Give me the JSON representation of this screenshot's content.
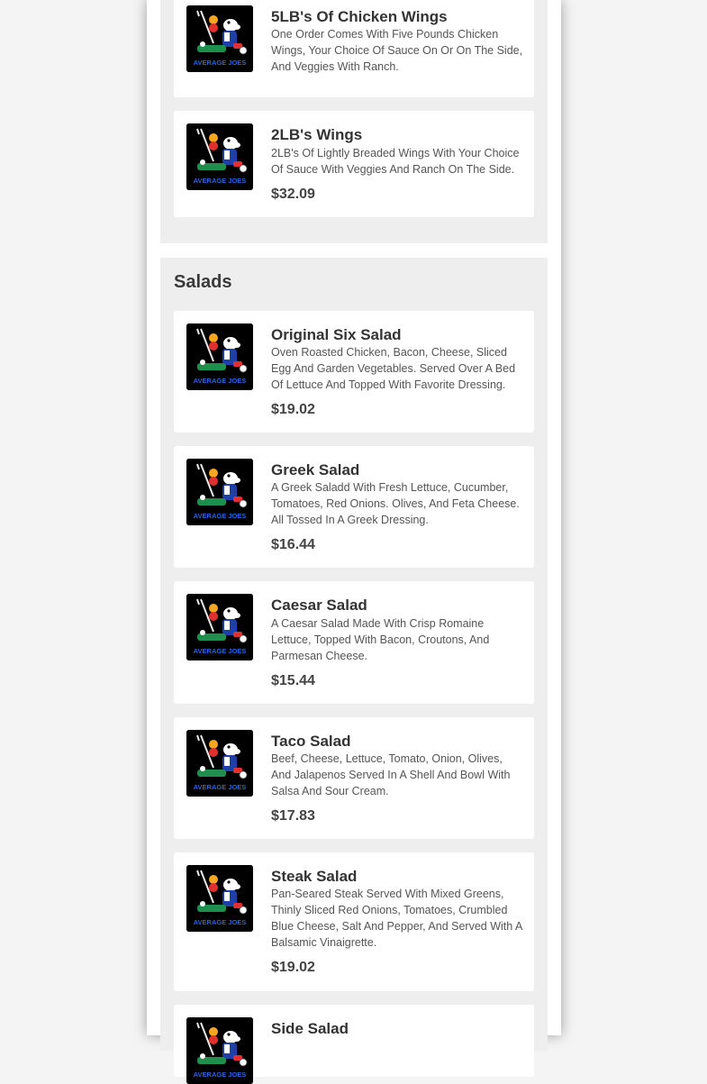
{
  "sections": [
    {
      "title": "",
      "items": [
        {
          "name": "5LB's Of Chicken Wings",
          "description": "One Order Comes With Five Pounds Chicken Wings, Your Choice Of Sauce On Or On The Side, And Veggies With Ranch.",
          "price": ""
        },
        {
          "name": "2LB's Wings",
          "description": "2LB's Of Lightly Breaded Wings With Your Choice Of Sauce With Veggies And Ranch On The Side.",
          "price": "$32.09"
        }
      ]
    },
    {
      "title": "Salads",
      "items": [
        {
          "name": "Original Six Salad",
          "description": "Oven Roasted Chicken, Bacon, Cheese, Sliced Egg And Garden Vegetables. Served Over A Bed Of Lettuce And Topped With Favorite Dressing.",
          "price": "$19.02"
        },
        {
          "name": "Greek Salad",
          "description": "A Greek Saladd With Fresh Lettuce, Cucumber, Tomatoes, Red Onions. Olives, And Feta Cheese. All Tossed In A Greek Dressing.",
          "price": "$16.44"
        },
        {
          "name": "Caesar Salad",
          "description": "A Caesar Salad Made With Crisp Romaine Lettuce, Topped With Bacon, Croutons, And Parmesan Cheese.",
          "price": "$15.44"
        },
        {
          "name": "Taco Salad",
          "description": "Beef, Cheese, Lettuce, Tomato, Onion, Olives, And Jalapenos Served In A Shell And Bowl With Salsa And Sour Cream.",
          "price": "$17.83"
        },
        {
          "name": "Steak Salad",
          "description": "Pan-Seared Steak Served With Mixed Greens, Thinly Sliced Red Onions, Tomatoes, Crumbled Blue Cheese, Salt And Pepper, And Served With A Balsamic Vinaigrette.",
          "price": "$19.02"
        },
        {
          "name": "Side Salad",
          "description": "",
          "price": ""
        }
      ]
    }
  ],
  "logo": {
    "icon": "average-joes-logo-icon",
    "text": "AVERAGE JOES"
  },
  "colors": {
    "background": "#f4f4f4",
    "section": "#eeeeee",
    "card": "#ffffff",
    "thumb": "#000000"
  }
}
